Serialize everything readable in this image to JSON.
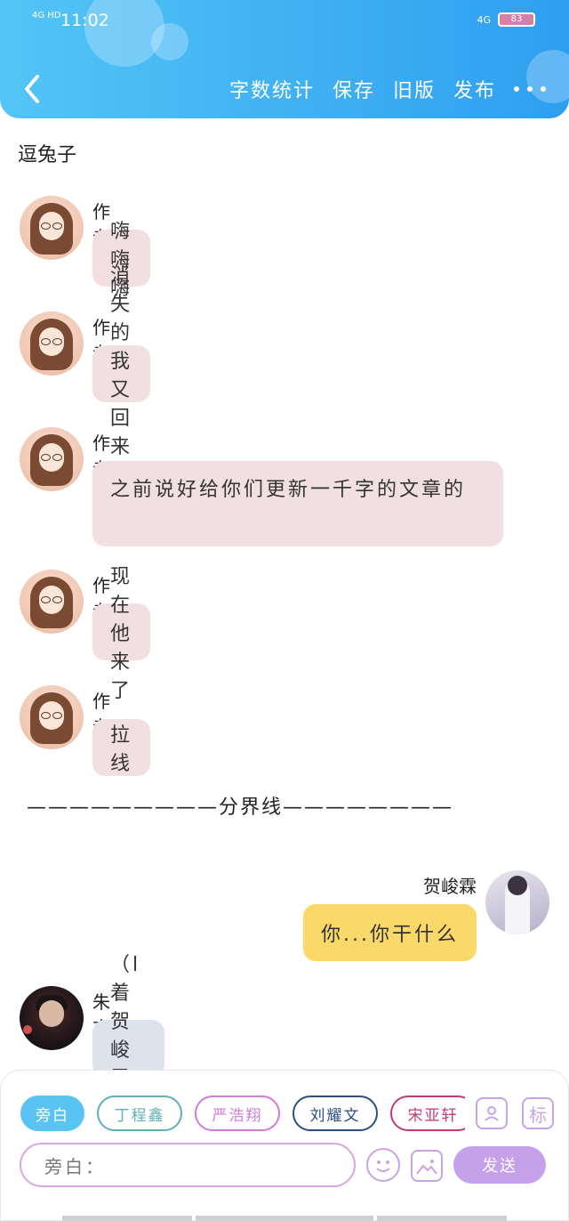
{
  "status_bar": {
    "signal": "4G HD",
    "time": "11:02",
    "network": "4G",
    "battery": "83"
  },
  "header": {
    "back_icon": "chevron-left-icon",
    "actions": [
      "字数统计",
      "保存",
      "旧版",
      "发布"
    ],
    "more_icon": "more-horizontal-icon"
  },
  "story_title": "逗兔子",
  "messages": [
    {
      "sender": "作者",
      "text": "嗨嗨嗨",
      "style": "pink"
    },
    {
      "sender": "作者",
      "text": "消失的我又回来了",
      "style": "pink"
    },
    {
      "sender": "作者",
      "text": "之前说好给你们更新一千字的文章的",
      "style": "pink"
    },
    {
      "sender": "作者",
      "text": "现在他来了",
      "style": "pink"
    },
    {
      "sender": "作者",
      "text": "拉线",
      "style": "pink"
    }
  ],
  "divider_text": "—————————分界线————————",
  "messages_after": [
    {
      "sender": "贺峻霖",
      "text": "你...你干什么",
      "style": "yellow",
      "align": "right"
    },
    {
      "sender": "朱志鑫",
      "text": "（l着贺峻霖的y）",
      "style": "gray",
      "align": "left"
    }
  ],
  "role_chips": [
    {
      "label": "旁白",
      "color": "#59c3f2",
      "active": true
    },
    {
      "label": "丁程鑫",
      "color": "#5fb0b7",
      "active": false
    },
    {
      "label": "严浩翔",
      "color": "#d27ad8",
      "active": false
    },
    {
      "label": "刘耀文",
      "color": "#2c4d86",
      "active": false
    },
    {
      "label": "宋亚轩",
      "color": "#c23a7a",
      "active": false
    }
  ],
  "toolbar": {
    "role_icon": "person-card-icon",
    "tag_label": "标",
    "input_placeholder": "旁白：",
    "emoji_icon": "emoji-icon",
    "image_icon": "image-icon",
    "send_label": "发送"
  }
}
